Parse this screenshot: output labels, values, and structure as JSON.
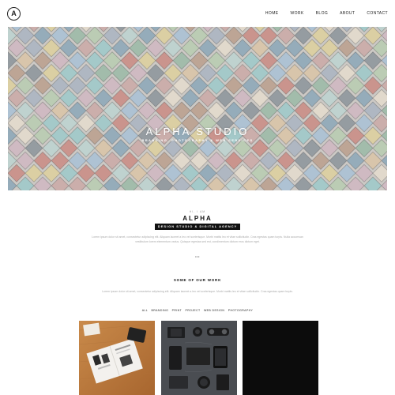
{
  "header": {
    "logo_letter": "A",
    "nav": [
      "HOME",
      "WORK",
      "BLOG",
      "ABOUT",
      "CONTACT"
    ]
  },
  "hero": {
    "title": "ALPHA STUDIO",
    "subtitle": "BRANDING, PHOTOGRAPHY & WEB SERVICES"
  },
  "intro": {
    "kicker": "HI, I AM",
    "brand": "ALPHA",
    "tagline": "DESIGN STUDIO & DIGITAL AGENCY",
    "text": "Lorem ipsum dolor sit amet, consectetur adipiscing elit. Aliquam laoreet a leo vel scelerisque. Morbi mattis leo et vitae sollicitudin. Cras egestas quam turpis. Nulla accumsan vestibulum lorem elementum varius. Quisque egestas sed est, condimentum dictum eros dictum eget.",
    "dots": "•••"
  },
  "work": {
    "heading": "SOME OF OUR WORK",
    "text": "Lorem ipsum dolor sit amet, consectetur adipiscing elit. Aliquam laoreet a leo vel scelerisque. Morbi mattis leo et vitae sollicitudin. Cras egestas quam turpis.",
    "filters": [
      "ALL",
      "BRANDING",
      "PRINT",
      "PROJECT",
      "WEB DESIGN",
      "PHOTOGRAPHY"
    ]
  },
  "colors": {
    "accent": "#111111",
    "muted_text": "#aaaaaa",
    "background": "#ffffff"
  }
}
